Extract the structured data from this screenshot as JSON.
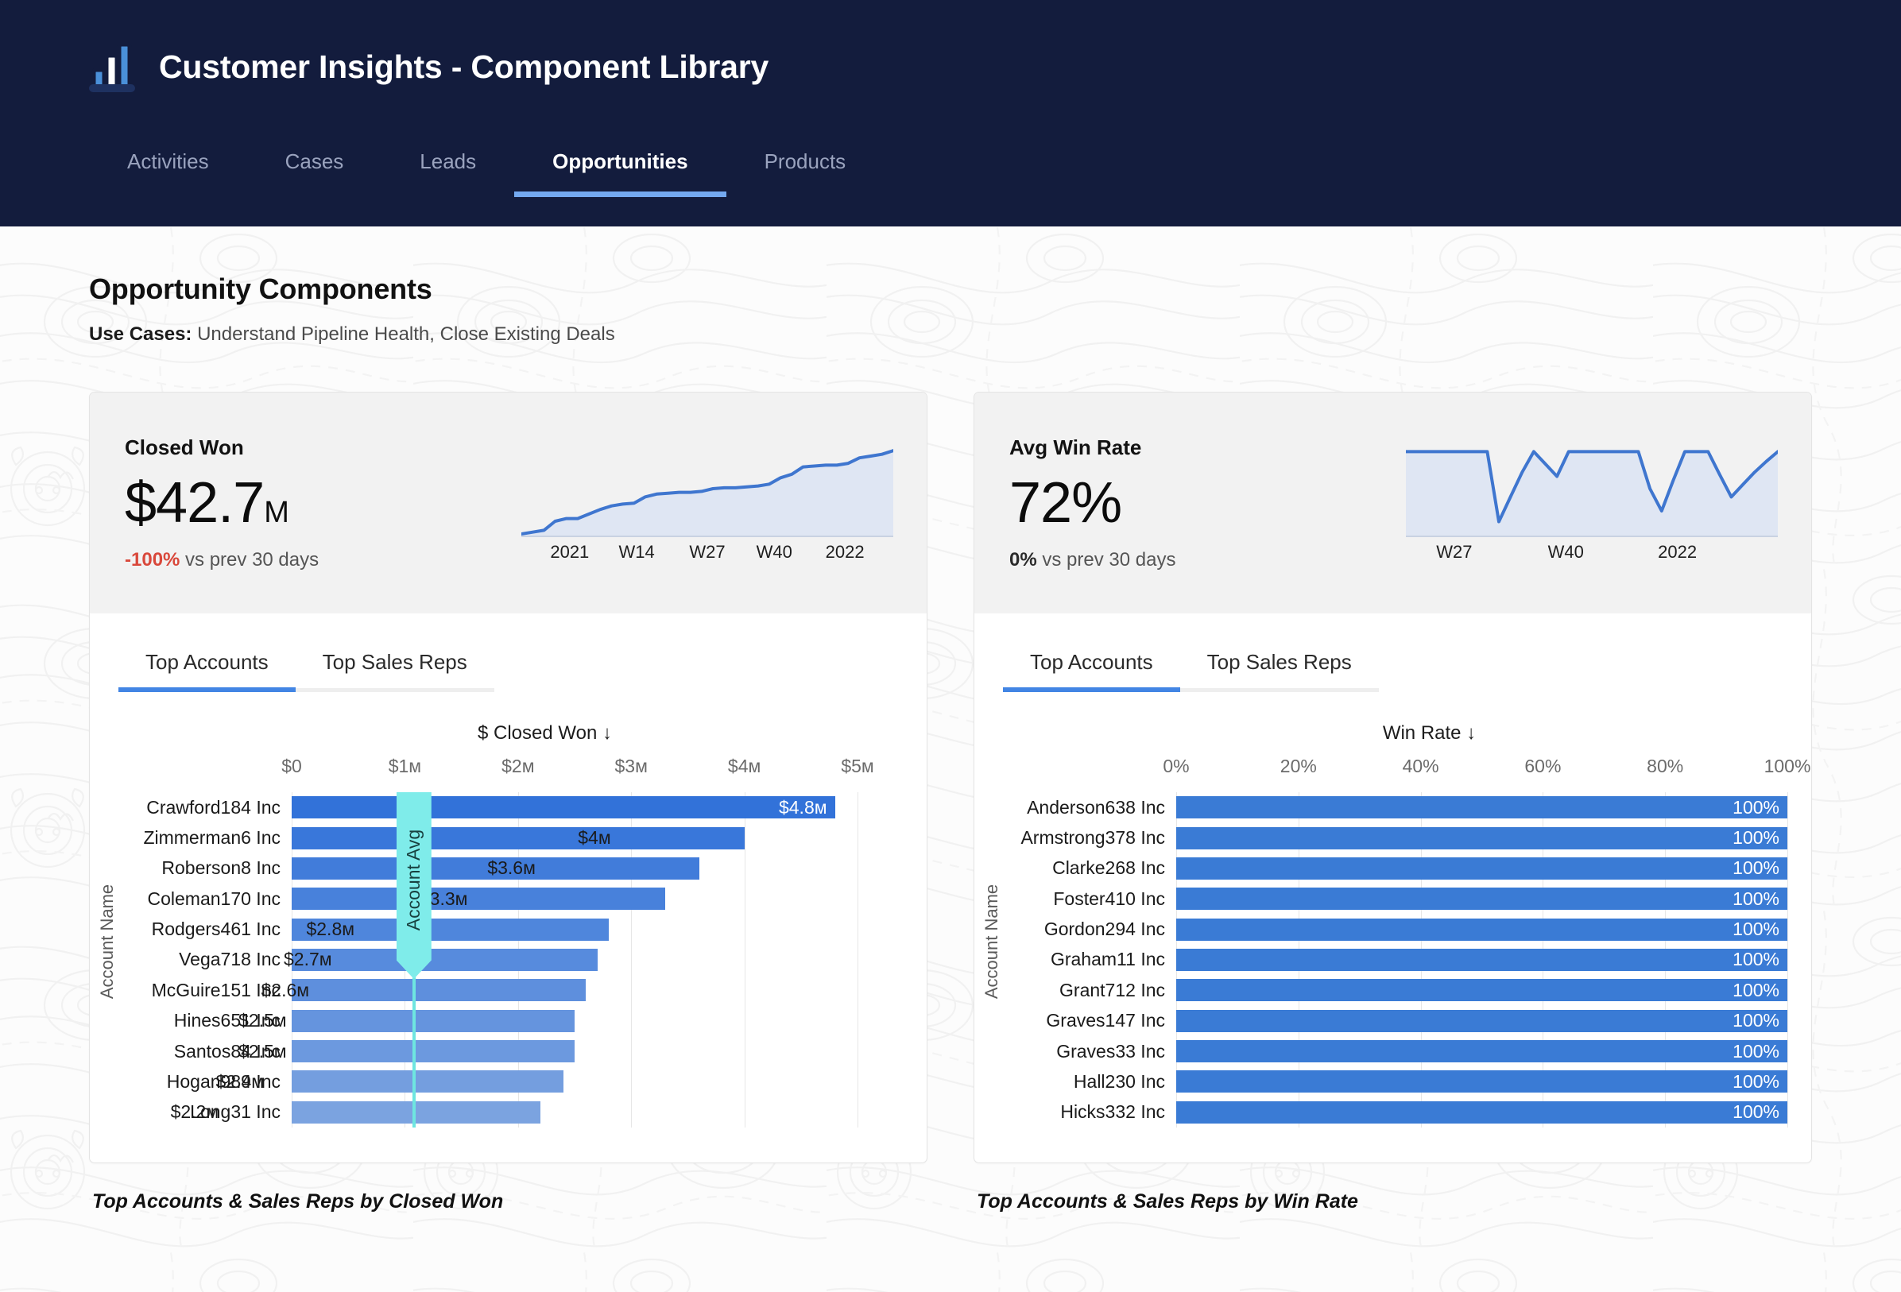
{
  "appbar": {
    "logo_icon": "bar-chart-icon",
    "title": "Customer Insights - Component Library",
    "tabs": [
      {
        "label": "Activities",
        "active": false
      },
      {
        "label": "Cases",
        "active": false
      },
      {
        "label": "Leads",
        "active": false
      },
      {
        "label": "Opportunities",
        "active": true
      },
      {
        "label": "Products",
        "active": false
      }
    ],
    "bg_color": "#131c3d",
    "active_underline_color": "#74a9f0"
  },
  "page": {
    "title": "Opportunity Components",
    "use_cases_label": "Use Cases:",
    "use_cases_value": " Understand Pipeline Health, Close Existing Deals"
  },
  "colors": {
    "accent_blue": "#4285e4",
    "bar_dark": "#3272d9",
    "bar_light": "#7ba3e0",
    "negative_red": "#d9483b",
    "ref_cyan": "#7fecea",
    "right_bar": "#3a7bd5"
  },
  "cards": [
    {
      "kpi": {
        "label": "Closed Won",
        "value": "$42.7",
        "value_suffix": "M",
        "delta": "-100%",
        "delta_tone": "negative",
        "delta_suffix": " vs prev 30 days"
      },
      "sparkline": {
        "type": "area",
        "ticks": [
          "2021",
          "W14",
          "W27",
          "W40",
          "2022"
        ],
        "tick_positions_pct": [
          13,
          31,
          50,
          68,
          87
        ],
        "values": [
          0,
          2,
          4,
          14,
          17,
          17,
          22,
          27,
          31,
          33,
          34,
          41,
          44,
          45,
          46,
          46,
          47,
          50,
          51,
          51,
          52,
          53,
          55,
          62,
          66,
          74,
          75,
          76,
          76,
          78,
          84,
          86,
          88,
          92
        ],
        "ymax": 100
      },
      "tabs": [
        {
          "label": "Top Accounts",
          "active": true
        },
        {
          "label": "Top Sales Reps",
          "active": false
        }
      ],
      "chart_ref": 0,
      "caption": "Top Accounts & Sales Reps by Closed Won"
    },
    {
      "kpi": {
        "label": "Avg Win Rate",
        "value": "72%",
        "value_suffix": "",
        "delta": "0%",
        "delta_tone": "flat",
        "delta_suffix": " vs prev 30 days"
      },
      "sparkline": {
        "type": "area",
        "ticks": [
          "W27",
          "W40",
          "2022"
        ],
        "tick_positions_pct": [
          13,
          43,
          73
        ],
        "values": [
          100,
          100,
          100,
          100,
          100,
          100,
          100,
          100,
          15,
          45,
          75,
          100,
          85,
          70,
          100,
          100,
          100,
          100,
          100,
          100,
          100,
          55,
          28,
          65,
          100,
          100,
          100,
          72,
          45,
          60,
          75,
          88,
          100
        ],
        "ymax": 110
      },
      "tabs": [
        {
          "label": "Top Accounts",
          "active": true
        },
        {
          "label": "Top Sales Reps",
          "active": false
        }
      ],
      "chart_ref": 1,
      "caption": "Top Accounts & Sales Reps by Win Rate"
    }
  ],
  "chart_data": [
    {
      "type": "bar",
      "orientation": "horizontal",
      "title": "$ Closed Won ↓",
      "ylabel": "Account Name",
      "xlabel": "",
      "xlim": [
        0,
        5400000
      ],
      "grid": true,
      "tick_labels": [
        "$0",
        "$1ᴍ",
        "$2ᴍ",
        "$3ᴍ",
        "$4ᴍ",
        "$5ᴍ"
      ],
      "tick_values": [
        0,
        1000000,
        2000000,
        3000000,
        4000000,
        5000000
      ],
      "categories": [
        "Crawford184 Inc",
        "Zimmerman6 Inc",
        "Roberson8 Inc",
        "Coleman170 Inc",
        "Rodgers461 Inc",
        "Vega718 Inc",
        "McGuire151 Inc",
        "Hines651 Inc",
        "Santos84 Inc",
        "Hogan989 Inc",
        "Long31 Inc"
      ],
      "values": [
        4800000,
        4000000,
        3600000,
        3300000,
        2800000,
        2700000,
        2600000,
        2500000,
        2500000,
        2400000,
        2200000
      ],
      "data_labels": [
        "$4.8ᴍ",
        "$4ᴍ",
        "$3.6ᴍ",
        "$3.3ᴍ",
        "$2.8ᴍ",
        "$2.7ᴍ",
        "$2.6ᴍ",
        "$2.5ᴍ",
        "$2.5ᴍ",
        "$2.4ᴍ",
        "$2.2ᴍ"
      ],
      "label_inside": [
        true,
        false,
        false,
        false,
        false,
        false,
        false,
        false,
        false,
        false,
        false
      ],
      "reference_line": {
        "label": "Account Avg",
        "value": 1080000
      }
    },
    {
      "type": "bar",
      "orientation": "horizontal",
      "title": "Win Rate ↓",
      "ylabel": "Account Name",
      "xlabel": "",
      "xlim": [
        0,
        100
      ],
      "grid": true,
      "tick_labels": [
        "0%",
        "20%",
        "40%",
        "60%",
        "80%",
        "100%"
      ],
      "tick_values": [
        0,
        20,
        40,
        60,
        80,
        100
      ],
      "categories": [
        "Anderson638 Inc",
        "Armstrong378 Inc",
        "Clarke268 Inc",
        "Foster410 Inc",
        "Gordon294 Inc",
        "Graham11 Inc",
        "Grant712 Inc",
        "Graves147 Inc",
        "Graves33 Inc",
        "Hall230 Inc",
        "Hicks332 Inc"
      ],
      "values": [
        100,
        100,
        100,
        100,
        100,
        100,
        100,
        100,
        100,
        100,
        100
      ],
      "data_labels": [
        "100%",
        "100%",
        "100%",
        "100%",
        "100%",
        "100%",
        "100%",
        "100%",
        "100%",
        "100%",
        "100%"
      ],
      "label_inside": [
        true,
        true,
        true,
        true,
        true,
        true,
        true,
        true,
        true,
        true,
        true
      ],
      "reference_line": null
    }
  ]
}
